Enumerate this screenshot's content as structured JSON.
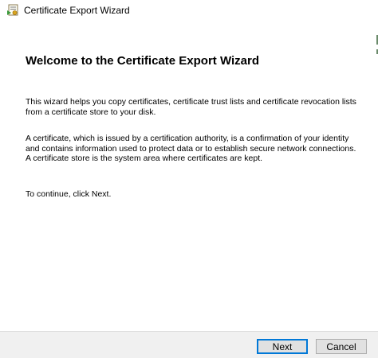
{
  "window": {
    "title": "Certificate Export Wizard",
    "app_icon": "certificate-wizard-icon"
  },
  "content": {
    "heading": "Welcome to the Certificate Export Wizard",
    "paragraphs": [
      "This wizard helps you copy certificates, certificate trust lists and certificate revocation lists from a certificate store to your disk.",
      "A certificate, which is issued by a certification authority, is a confirmation of your identity and contains information used to protect data or to establish secure network connections. A certificate store is the system area where certificates are kept.",
      "To continue, click Next."
    ]
  },
  "buttons": {
    "next": "Next",
    "cancel": "Cancel"
  },
  "colors": {
    "default_button_border": "#0078d7",
    "footer_background": "#f0f0f0"
  }
}
